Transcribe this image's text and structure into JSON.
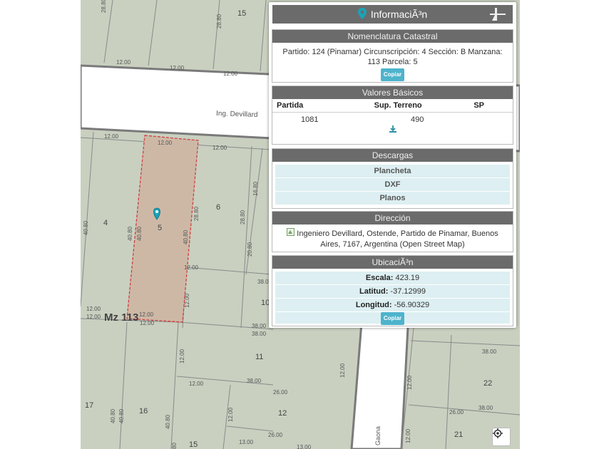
{
  "map": {
    "labels": {
      "mz": "Mz 113",
      "street_devillard": "Ing. Devillard",
      "street_gaona": "Gaona",
      "lots": [
        "15",
        "4",
        "5",
        "6",
        "10",
        "11",
        "12",
        "16",
        "17",
        "22",
        "21",
        "15"
      ],
      "dims": [
        "28.80",
        "28.80",
        "12.00",
        "12.00",
        "12.00",
        "12.00",
        "12.00",
        "12.00",
        "12.00",
        "12.00",
        "40.80",
        "40.80",
        "40.80",
        "28.80",
        "40.80",
        "28.80",
        "16.80",
        "20.80",
        "12.00",
        "38.00",
        "12.00",
        "12.00",
        "12.00",
        "38.00",
        "38.00",
        "12.00",
        "12.00",
        "38.00",
        "26.00",
        "12.00",
        "12.00",
        "40.80",
        "40.80",
        "40.80",
        "26.00",
        "13.00",
        "13.00",
        "38.00",
        "26.00",
        "38.00",
        "12.00",
        "80"
      ]
    },
    "colors": {
      "ground": "#c9d0c0",
      "road": "#ffffff",
      "parcel_fill": "#cdb8a6",
      "parcel_border": "#d04040",
      "pin": "#1aa3b8"
    }
  },
  "panel": {
    "title": "InformaciÃ³n",
    "nomenclatura": {
      "title": "Nomenclatura Catastral",
      "text": "Partido: 124 (Pinamar) Circunscripción: 4 Sección: B Manzana: 113 Parcela: 5",
      "copy": "Copiar"
    },
    "valores": {
      "title": "Valores Básicos",
      "headers": [
        "Partida",
        "Sup. Terreno",
        "SP"
      ],
      "row": [
        "1081",
        "490",
        ""
      ]
    },
    "descargas": {
      "title": "Descargas",
      "items": [
        "Plancheta",
        "DXF",
        "Planos"
      ]
    },
    "direccion": {
      "title": "Dirección",
      "text": "Ingeniero Devillard, Ostende, Partido de Pinamar, Buenos Aires, 7167, Argentina (Open Street Map)"
    },
    "ubicacion": {
      "title": "UbicaciÃ³n",
      "escala_label": "Escala:",
      "escala": "423.19",
      "latitud_label": "Latitud:",
      "latitud": "-37.12999",
      "longitud_label": "Longitud:",
      "longitud": "-56.90329",
      "copy": "Copiar"
    }
  }
}
